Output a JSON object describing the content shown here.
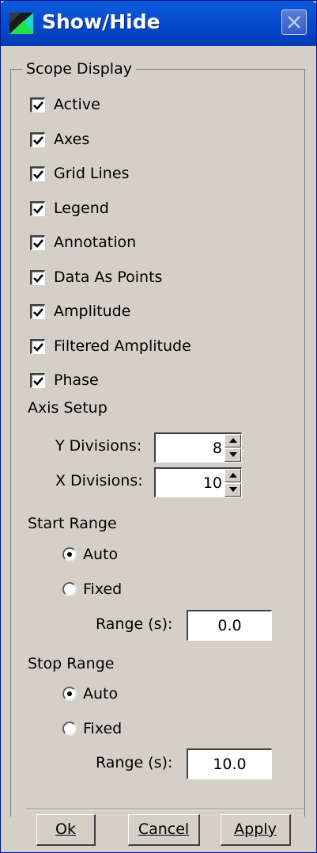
{
  "window": {
    "title": "Show/Hide"
  },
  "scope_display": {
    "legend": "Scope Display",
    "checkboxes": [
      {
        "label": "Active",
        "checked": true
      },
      {
        "label": "Axes",
        "checked": true
      },
      {
        "label": "Grid Lines",
        "checked": true
      },
      {
        "label": "Legend",
        "checked": true
      },
      {
        "label": "Annotation",
        "checked": true
      },
      {
        "label": "Data As Points",
        "checked": true
      },
      {
        "label": "Amplitude",
        "checked": true
      },
      {
        "label": "Filtered Amplitude",
        "checked": true
      },
      {
        "label": "Phase",
        "checked": true
      }
    ]
  },
  "axis_setup": {
    "heading": "Axis Setup",
    "y_divisions": {
      "label": "Y Divisions:",
      "value": "8"
    },
    "x_divisions": {
      "label": "X Divisions:",
      "value": "10"
    }
  },
  "start_range": {
    "heading": "Start Range",
    "auto_label": "Auto",
    "fixed_label": "Fixed",
    "selected": "Auto",
    "range_label": "Range (s):",
    "range_value": "0.0"
  },
  "stop_range": {
    "heading": "Stop Range",
    "auto_label": "Auto",
    "fixed_label": "Fixed",
    "selected": "Auto",
    "range_label": "Range (s):",
    "range_value": "10.0"
  },
  "buttons": {
    "ok": "Ok",
    "cancel": "Cancel",
    "apply": "Apply"
  },
  "colors": {
    "titlebar": "#0447c8",
    "dialog_bg": "#d4d0c8"
  },
  "icons": {
    "app": "scope-app-icon",
    "close": "close-icon",
    "check": "check-icon"
  }
}
